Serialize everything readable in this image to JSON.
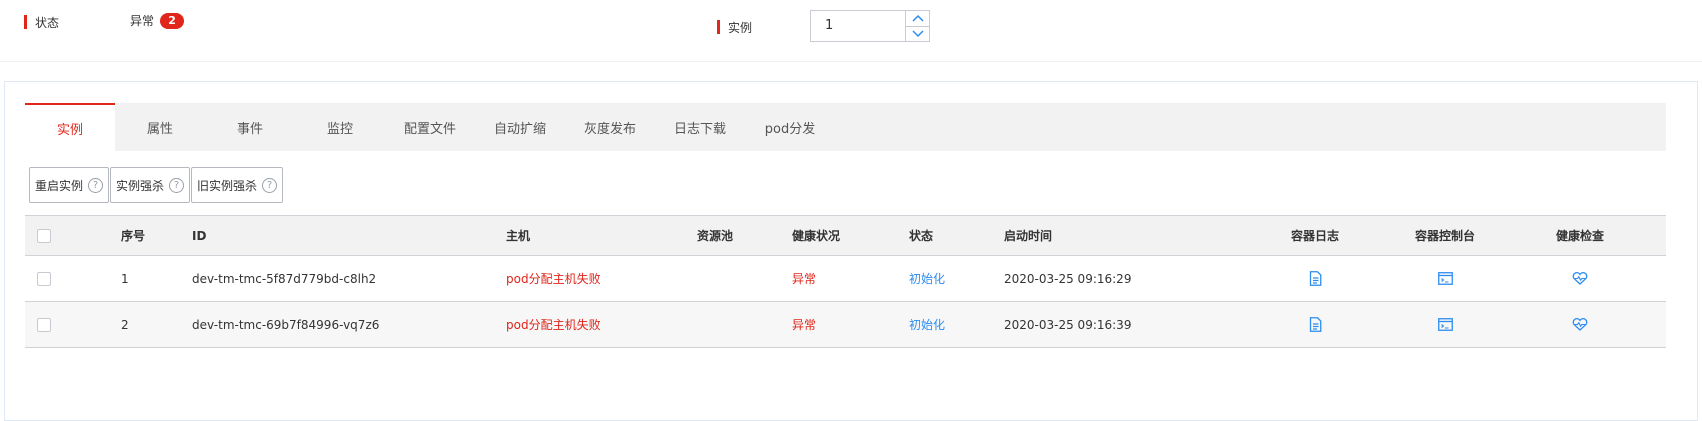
{
  "filters": {
    "status_label": "状态",
    "status_value": "异常",
    "status_count": "2",
    "instance_label": "实例",
    "instance_value": "1"
  },
  "tabs": [
    {
      "label": "实例",
      "active": true
    },
    {
      "label": "属性"
    },
    {
      "label": "事件"
    },
    {
      "label": "监控"
    },
    {
      "label": "配置文件"
    },
    {
      "label": "自动扩缩"
    },
    {
      "label": "灰度发布"
    },
    {
      "label": "日志下载"
    },
    {
      "label": "pod分发"
    }
  ],
  "actions": {
    "restart": "重启实例",
    "kill": "实例强杀",
    "kill_old": "旧实例强杀"
  },
  "table": {
    "headers": {
      "index": "序号",
      "id": "ID",
      "host": "主机",
      "pool": "资源池",
      "health": "健康状况",
      "state": "状态",
      "start_time": "启动时间",
      "log": "容器日志",
      "console": "容器控制台",
      "check": "健康检查"
    },
    "rows": [
      {
        "index": "1",
        "id": "dev-tm-tmc-5f87d779bd-c8lh2",
        "host": "pod分配主机失败",
        "pool": "",
        "health": "异常",
        "state": "初始化",
        "start_time": "2020-03-25 09:16:29"
      },
      {
        "index": "2",
        "id": "dev-tm-tmc-69b7f84996-vq7z6",
        "host": "pod分配主机失败",
        "pool": "",
        "health": "异常",
        "state": "初始化",
        "start_time": "2020-03-25 09:16:39"
      }
    ]
  },
  "icons": {
    "log": "document-icon",
    "console": "terminal-icon",
    "check": "heart-pulse-icon"
  },
  "colors": {
    "accent": "#e1251b",
    "link": "#2d8cf0"
  }
}
